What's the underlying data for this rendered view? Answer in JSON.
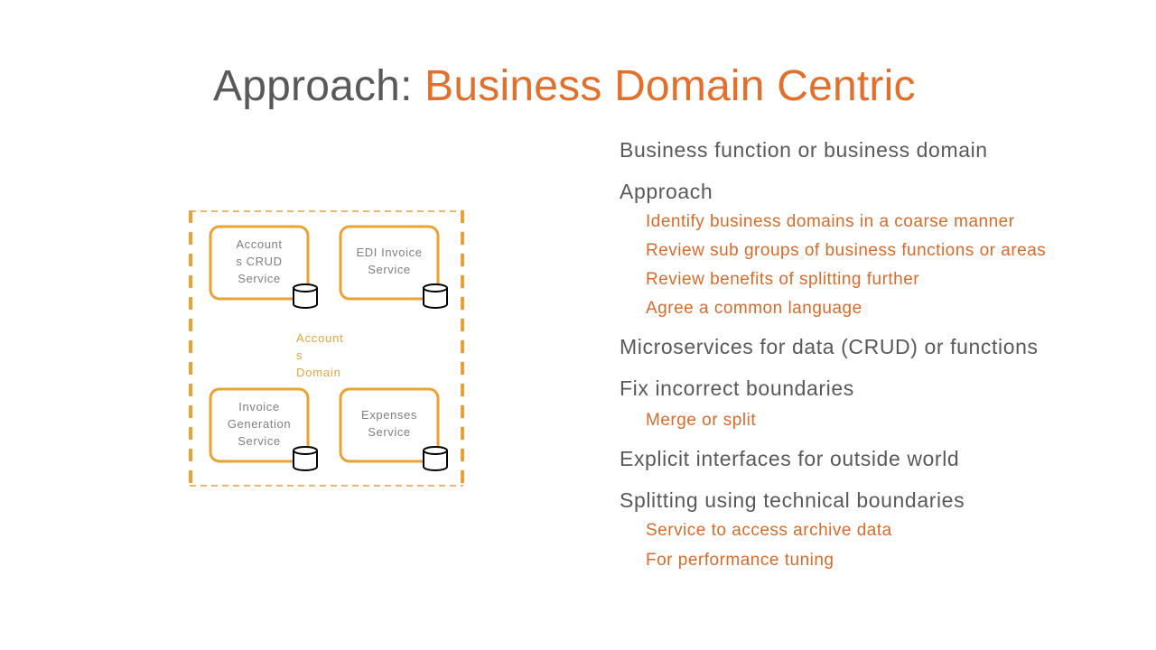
{
  "slide": {
    "title_lead": "Approach:",
    "title_accent": "Business Domain Centric"
  },
  "colors": {
    "title_gray": "#595959",
    "accent_orange": "#E2702C",
    "diagram_orange": "#EBA133",
    "service_text_gray": "#7f7f7f",
    "db_outline": "#000000"
  },
  "diagram": {
    "domain_label": "Account\ns\nDomain",
    "services": [
      {
        "label": "Account\ns CRUD\nService",
        "icon": "database-icon"
      },
      {
        "label": "EDI Invoice\nService",
        "icon": "database-icon"
      },
      {
        "label": "Invoice\nGeneration\nService",
        "icon": "database-icon"
      },
      {
        "label": "Expenses\nService",
        "icon": "database-icon"
      }
    ]
  },
  "bullets": [
    {
      "text": "Business function or business domain",
      "sub": []
    },
    {
      "text": "Approach",
      "sub": [
        "Identify business domains in a coarse manner",
        "Review sub groups of business functions or areas",
        "Review benefits of splitting further",
        "Agree a common language"
      ]
    },
    {
      "text": "Microservices for data (CRUD) or functions",
      "sub": []
    },
    {
      "text": "Fix incorrect boundaries",
      "sub": [
        "Merge or split"
      ]
    },
    {
      "text": "Explicit interfaces for outside world",
      "sub": []
    },
    {
      "text": "Splitting using technical boundaries",
      "sub": [
        "Service to access archive data",
        "For performance tuning"
      ]
    }
  ]
}
